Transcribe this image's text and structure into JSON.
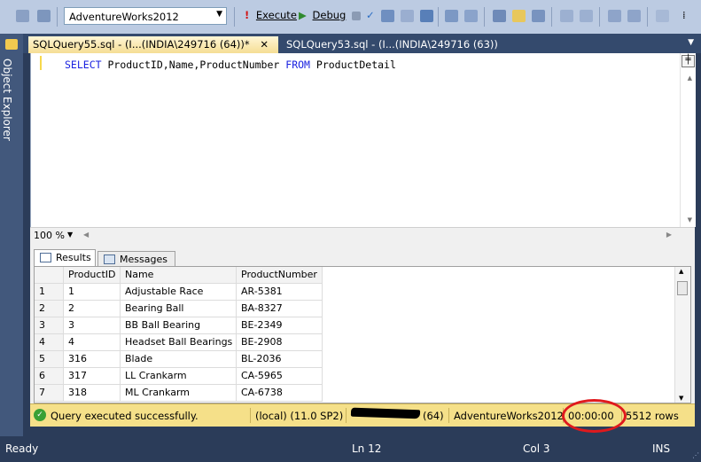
{
  "toolbar": {
    "database": "AdventureWorks2012",
    "execute_label": "Execute",
    "debug_label": "Debug"
  },
  "sidebar": {
    "label": "Object Explorer"
  },
  "tabs": [
    {
      "label": "SQLQuery55.sql - (I...(INDIA\\249716 (64))*"
    },
    {
      "label": "SQLQuery53.sql - (I...(INDIA\\249716 (63))"
    }
  ],
  "editor": {
    "kw_select": "SELECT",
    "columns": " ProductID,Name,ProductNumber ",
    "kw_from": "FROM",
    "table": " ProductDetail"
  },
  "zoom": {
    "value": "100 %"
  },
  "results": {
    "tabs": {
      "results": "Results",
      "messages": "Messages"
    },
    "columns": [
      "",
      "ProductID",
      "Name",
      "ProductNumber"
    ],
    "rows": [
      [
        "1",
        "1",
        "Adjustable Race",
        "AR-5381"
      ],
      [
        "2",
        "2",
        "Bearing Ball",
        "BA-8327"
      ],
      [
        "3",
        "3",
        "BB Ball Bearing",
        "BE-2349"
      ],
      [
        "4",
        "4",
        "Headset Ball Bearings",
        "BE-2908"
      ],
      [
        "5",
        "316",
        "Blade",
        "BL-2036"
      ],
      [
        "6",
        "317",
        "LL Crankarm",
        "CA-5965"
      ],
      [
        "7",
        "318",
        "ML Crankarm",
        "CA-6738"
      ]
    ]
  },
  "query_status": {
    "message": "Query executed successfully.",
    "server": "(local) (11.0 SP2)",
    "user_suffix": "(64)",
    "database": "AdventureWorks2012",
    "elapsed": "00:00:00",
    "rows": "5512 rows"
  },
  "status_bar": {
    "ready": "Ready",
    "line": "Ln 12",
    "col": "Col 3",
    "mode": "INS"
  },
  "colors": {
    "highlight_ring": "#e0191d",
    "status_yellow": "#f5e089",
    "chrome": "#2b3c59"
  }
}
